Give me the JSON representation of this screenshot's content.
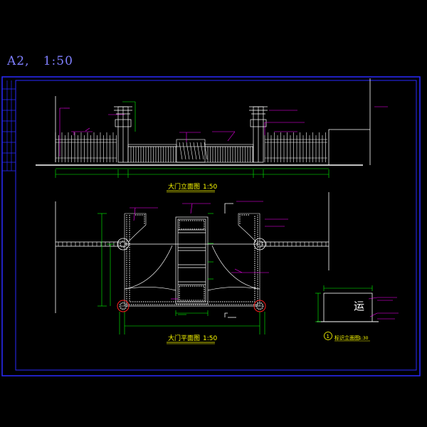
{
  "sheet": {
    "title": "A2,   1:50"
  },
  "views": {
    "elevation_caption": "大门立面图",
    "elevation_scale": "1:50",
    "plan_caption": "大门平面图",
    "plan_scale": "1:50",
    "detail_number": "1",
    "detail_caption": "标识立面图",
    "detail_scale": "1:30",
    "detail_glyph": "运"
  },
  "colors": {
    "background": "#000000",
    "frame": "#2a2aff",
    "linework": "#ffffff",
    "dimension": "#00ff00",
    "annotation": "#ff00ff",
    "caption": "#ffff00",
    "hatch": "#b0b0b0",
    "sheet_title": "#7f7fff",
    "pillar_marker": "#ff2020"
  }
}
